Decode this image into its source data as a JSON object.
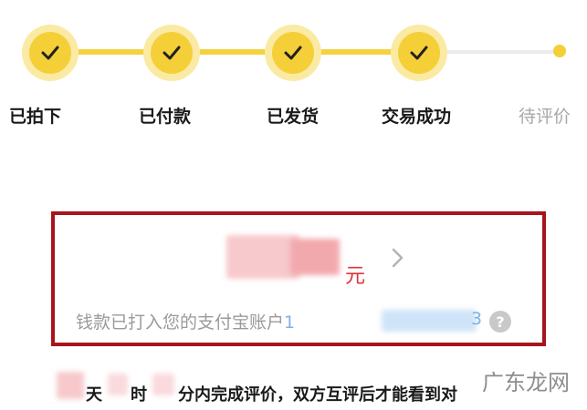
{
  "progress": {
    "steps": [
      {
        "label": "已拍下",
        "done": true
      },
      {
        "label": "已付款",
        "done": true
      },
      {
        "label": "已发货",
        "done": true
      },
      {
        "label": "交易成功",
        "done": true
      },
      {
        "label": "待评价",
        "done": false
      }
    ],
    "colors": {
      "active": "#f5cf38",
      "halo": "#fbeaa4",
      "inactive": "#ececec"
    }
  },
  "payment": {
    "amount_unit": "元",
    "account_text": "钱款已打入您的支付宝账户",
    "account_prefix_visible": "1",
    "account_suffix_visible": "3",
    "help_icon": "help-icon"
  },
  "review_notice": {
    "unit_day": "天",
    "unit_hour": "时",
    "text": "分内完成评价，双方互评后才能看到对"
  },
  "watermark": "广东龙网",
  "highlight_color": "#a8141c"
}
